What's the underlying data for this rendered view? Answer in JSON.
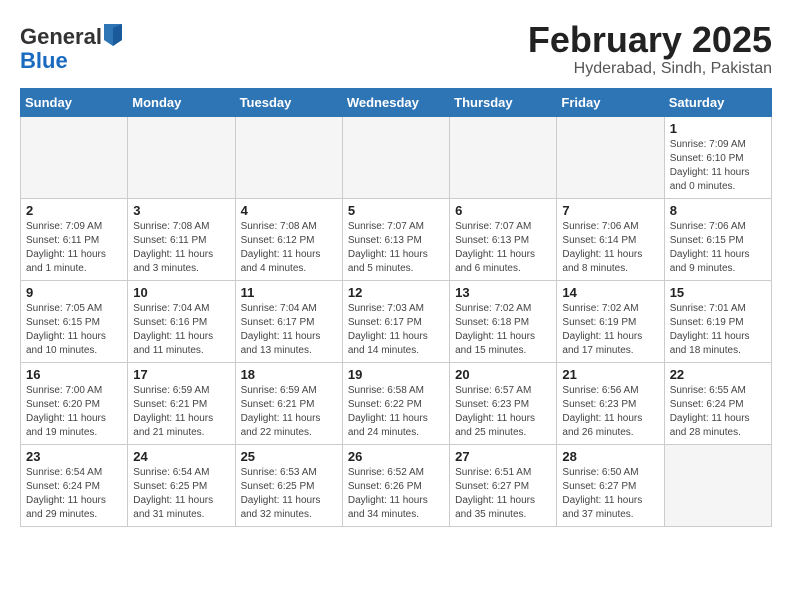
{
  "logo": {
    "general": "General",
    "blue": "Blue"
  },
  "header": {
    "title": "February 2025",
    "subtitle": "Hyderabad, Sindh, Pakistan"
  },
  "weekdays": [
    "Sunday",
    "Monday",
    "Tuesday",
    "Wednesday",
    "Thursday",
    "Friday",
    "Saturday"
  ],
  "weeks": [
    [
      {
        "day": "",
        "info": ""
      },
      {
        "day": "",
        "info": ""
      },
      {
        "day": "",
        "info": ""
      },
      {
        "day": "",
        "info": ""
      },
      {
        "day": "",
        "info": ""
      },
      {
        "day": "",
        "info": ""
      },
      {
        "day": "1",
        "info": "Sunrise: 7:09 AM\nSunset: 6:10 PM\nDaylight: 11 hours\nand 0 minutes."
      }
    ],
    [
      {
        "day": "2",
        "info": "Sunrise: 7:09 AM\nSunset: 6:11 PM\nDaylight: 11 hours\nand 1 minute."
      },
      {
        "day": "3",
        "info": "Sunrise: 7:08 AM\nSunset: 6:11 PM\nDaylight: 11 hours\nand 3 minutes."
      },
      {
        "day": "4",
        "info": "Sunrise: 7:08 AM\nSunset: 6:12 PM\nDaylight: 11 hours\nand 4 minutes."
      },
      {
        "day": "5",
        "info": "Sunrise: 7:07 AM\nSunset: 6:13 PM\nDaylight: 11 hours\nand 5 minutes."
      },
      {
        "day": "6",
        "info": "Sunrise: 7:07 AM\nSunset: 6:13 PM\nDaylight: 11 hours\nand 6 minutes."
      },
      {
        "day": "7",
        "info": "Sunrise: 7:06 AM\nSunset: 6:14 PM\nDaylight: 11 hours\nand 8 minutes."
      },
      {
        "day": "8",
        "info": "Sunrise: 7:06 AM\nSunset: 6:15 PM\nDaylight: 11 hours\nand 9 minutes."
      }
    ],
    [
      {
        "day": "9",
        "info": "Sunrise: 7:05 AM\nSunset: 6:15 PM\nDaylight: 11 hours\nand 10 minutes."
      },
      {
        "day": "10",
        "info": "Sunrise: 7:04 AM\nSunset: 6:16 PM\nDaylight: 11 hours\nand 11 minutes."
      },
      {
        "day": "11",
        "info": "Sunrise: 7:04 AM\nSunset: 6:17 PM\nDaylight: 11 hours\nand 13 minutes."
      },
      {
        "day": "12",
        "info": "Sunrise: 7:03 AM\nSunset: 6:17 PM\nDaylight: 11 hours\nand 14 minutes."
      },
      {
        "day": "13",
        "info": "Sunrise: 7:02 AM\nSunset: 6:18 PM\nDaylight: 11 hours\nand 15 minutes."
      },
      {
        "day": "14",
        "info": "Sunrise: 7:02 AM\nSunset: 6:19 PM\nDaylight: 11 hours\nand 17 minutes."
      },
      {
        "day": "15",
        "info": "Sunrise: 7:01 AM\nSunset: 6:19 PM\nDaylight: 11 hours\nand 18 minutes."
      }
    ],
    [
      {
        "day": "16",
        "info": "Sunrise: 7:00 AM\nSunset: 6:20 PM\nDaylight: 11 hours\nand 19 minutes."
      },
      {
        "day": "17",
        "info": "Sunrise: 6:59 AM\nSunset: 6:21 PM\nDaylight: 11 hours\nand 21 minutes."
      },
      {
        "day": "18",
        "info": "Sunrise: 6:59 AM\nSunset: 6:21 PM\nDaylight: 11 hours\nand 22 minutes."
      },
      {
        "day": "19",
        "info": "Sunrise: 6:58 AM\nSunset: 6:22 PM\nDaylight: 11 hours\nand 24 minutes."
      },
      {
        "day": "20",
        "info": "Sunrise: 6:57 AM\nSunset: 6:23 PM\nDaylight: 11 hours\nand 25 minutes."
      },
      {
        "day": "21",
        "info": "Sunrise: 6:56 AM\nSunset: 6:23 PM\nDaylight: 11 hours\nand 26 minutes."
      },
      {
        "day": "22",
        "info": "Sunrise: 6:55 AM\nSunset: 6:24 PM\nDaylight: 11 hours\nand 28 minutes."
      }
    ],
    [
      {
        "day": "23",
        "info": "Sunrise: 6:54 AM\nSunset: 6:24 PM\nDaylight: 11 hours\nand 29 minutes."
      },
      {
        "day": "24",
        "info": "Sunrise: 6:54 AM\nSunset: 6:25 PM\nDaylight: 11 hours\nand 31 minutes."
      },
      {
        "day": "25",
        "info": "Sunrise: 6:53 AM\nSunset: 6:25 PM\nDaylight: 11 hours\nand 32 minutes."
      },
      {
        "day": "26",
        "info": "Sunrise: 6:52 AM\nSunset: 6:26 PM\nDaylight: 11 hours\nand 34 minutes."
      },
      {
        "day": "27",
        "info": "Sunrise: 6:51 AM\nSunset: 6:27 PM\nDaylight: 11 hours\nand 35 minutes."
      },
      {
        "day": "28",
        "info": "Sunrise: 6:50 AM\nSunset: 6:27 PM\nDaylight: 11 hours\nand 37 minutes."
      },
      {
        "day": "",
        "info": ""
      }
    ]
  ]
}
